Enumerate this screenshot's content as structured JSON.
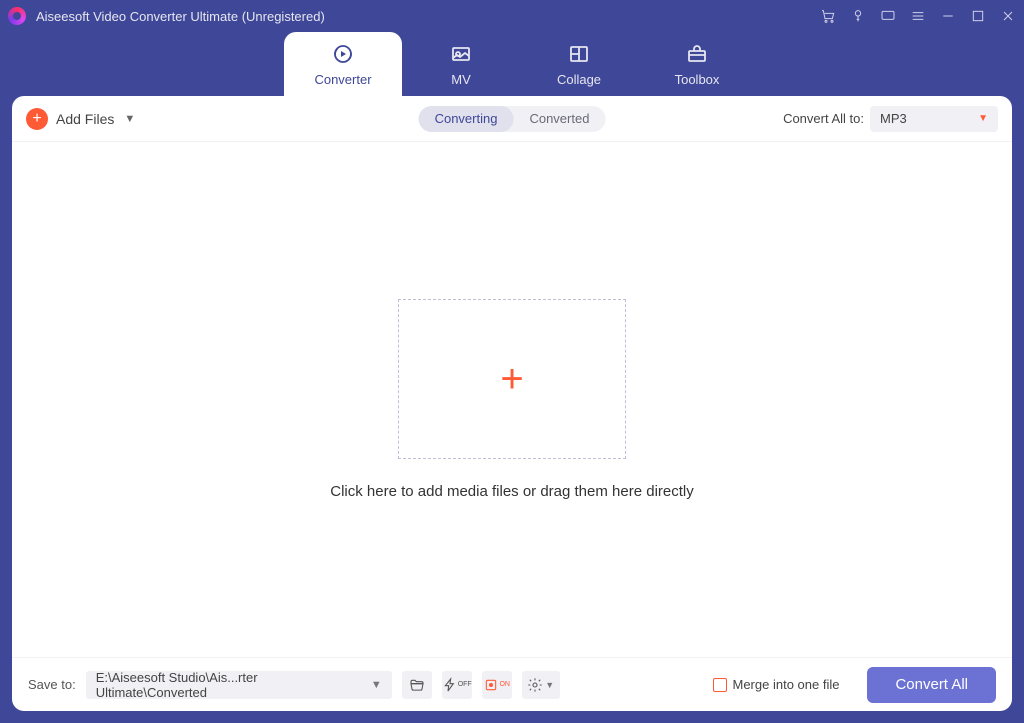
{
  "titlebar": {
    "title": "Aiseesoft Video Converter Ultimate (Unregistered)"
  },
  "mainTabs": {
    "converter": "Converter",
    "mv": "MV",
    "collage": "Collage",
    "toolbox": "Toolbox"
  },
  "toolbar": {
    "addFiles": "Add Files",
    "converting": "Converting",
    "converted": "Converted",
    "convertAllTo": "Convert All to:",
    "format": "MP3"
  },
  "dropzone": {
    "hint": "Click here to add media files or drag them here directly"
  },
  "bottombar": {
    "saveTo": "Save to:",
    "path": "E:\\Aiseesoft Studio\\Ais...rter Ultimate\\Converted",
    "merge": "Merge into one file",
    "convertAll": "Convert All"
  }
}
